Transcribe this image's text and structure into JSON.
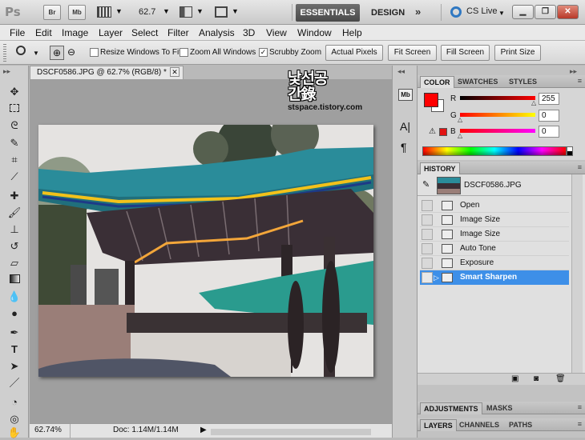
{
  "appbar": {
    "logo": "Ps",
    "bridge": "Br",
    "minibridge": "Mb",
    "zoom": "62.7",
    "workspace_active": "ESSENTIALS",
    "workspace_other": "DESIGN",
    "more": "»",
    "cslive": "CS Live"
  },
  "menu": [
    "File",
    "Edit",
    "Image",
    "Layer",
    "Select",
    "Filter",
    "Analysis",
    "3D",
    "View",
    "Window",
    "Help"
  ],
  "options": {
    "resize_windows": "Resize Windows To Fit",
    "zoom_all": "Zoom All Windows",
    "scrubby_zoom": "Scrubby Zoom",
    "actual_pixels": "Actual Pixels",
    "fit_screen": "Fit Screen",
    "fill_screen": "Fill Screen",
    "print_size": "Print Size"
  },
  "document": {
    "tab_title": "DSCF0586.JPG @ 62.7% (RGB/8) *",
    "watermark_url": "stspace.tistory.com",
    "watermark_text": "낯선공간錄",
    "status_zoom": "62.74%",
    "status_doc": "Doc: 1.14M/1.14M"
  },
  "color_panel": {
    "tabs": [
      "COLOR",
      "SWATCHES",
      "STYLES"
    ],
    "channels": [
      {
        "label": "R",
        "value": "255"
      },
      {
        "label": "G",
        "value": "0"
      },
      {
        "label": "B",
        "value": "0"
      }
    ],
    "foreground": "#ff0000",
    "background": "#ffffff"
  },
  "history_panel": {
    "tab": "HISTORY",
    "snapshot": "DSCF0586.JPG",
    "steps": [
      "Open",
      "Image Size",
      "Image Size",
      "Auto Tone",
      "Exposure",
      "Smart Sharpen"
    ],
    "selected_index": 5
  },
  "adjust_tabs": [
    "ADJUSTMENTS",
    "MASKS"
  ],
  "layer_tabs": [
    "LAYERS",
    "CHANNELS",
    "PATHS"
  ]
}
